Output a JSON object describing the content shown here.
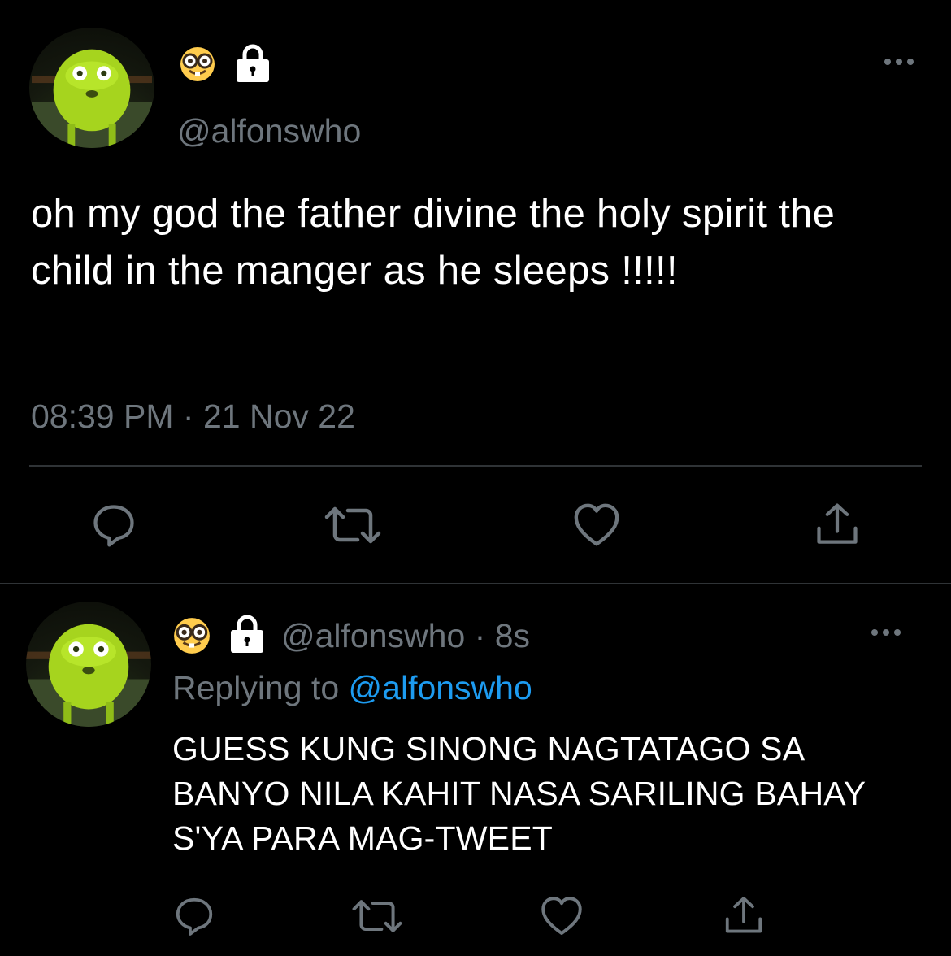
{
  "main_tweet": {
    "handle": "@alfonswho",
    "text": "oh my god the father divine the holy spirit the child in the manger as he sleeps !!!!!",
    "time": "08:39 PM",
    "separator": "·",
    "date": "21 Nov 22",
    "icons": [
      "nerd-face-emoji",
      "lock-icon",
      "more-options-icon",
      "reply-icon",
      "retweet-icon",
      "like-icon",
      "share-icon"
    ]
  },
  "reply_tweet": {
    "handle": "@alfonswho",
    "separator": "·",
    "age": "8s",
    "replying_prefix": "Replying to",
    "replying_handle": "@alfonswho",
    "text": "GUESS KUNG SINONG NAGTATAGO SA BANYO NILA KAHIT NASA SARILING BAHAY S'YA PARA MAG-TWEET",
    "icons": [
      "nerd-face-emoji",
      "lock-icon",
      "more-options-icon",
      "reply-icon",
      "retweet-icon",
      "like-icon",
      "share-icon"
    ]
  },
  "colors": {
    "background": "#000000",
    "text": "#ffffff",
    "muted": "#6e767d",
    "link": "#1d9bf0",
    "divider": "#2f3336"
  }
}
